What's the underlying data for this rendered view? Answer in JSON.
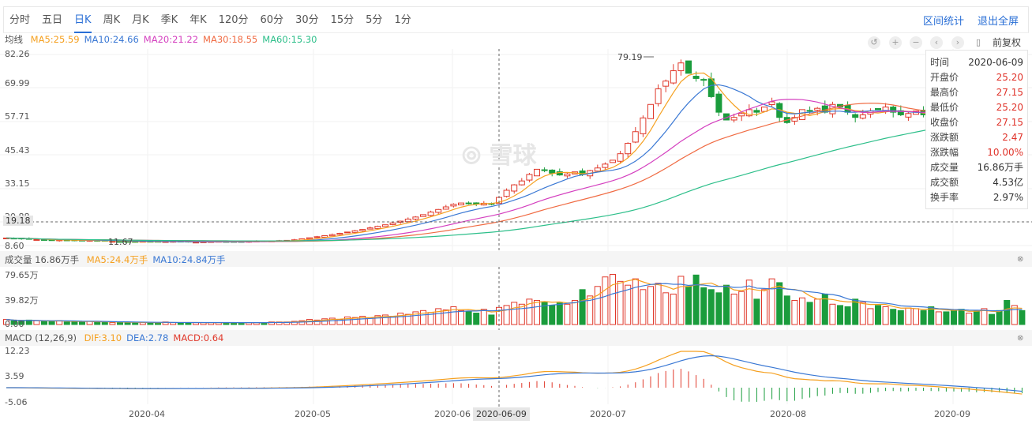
{
  "tabs": [
    "分时",
    "五日",
    "日K",
    "周K",
    "月K",
    "季K",
    "年K",
    "120分",
    "60分",
    "30分",
    "15分",
    "5分",
    "1分"
  ],
  "active_tab": "日K",
  "links": {
    "range_stats": "区间统计",
    "exit_fullscreen": "退出全屏"
  },
  "toolbar": {
    "adjust": "前复权",
    "icons": [
      "undo-icon",
      "zoom-in-icon",
      "zoom-out-icon",
      "prev-icon",
      "next-icon",
      "battery-icon"
    ]
  },
  "ma_legend": {
    "label": "均线",
    "ma5": "MA5:25.59",
    "ma10": "MA10:24.66",
    "ma20": "MA20:21.22",
    "ma30": "MA30:18.55",
    "ma60": "MA60:15.30"
  },
  "vol_legend": {
    "label": "成交量 16.86万手",
    "ma5": "MA5:24.4万手",
    "ma10": "MA10:24.84万手"
  },
  "macd_legend": {
    "label": "MACD (12,26,9)",
    "dif": "DIF:3.10",
    "dea": "DEA:2.78",
    "macd": "MACD:0.64"
  },
  "price_axis": [
    "82.26",
    "69.99",
    "57.71",
    "45.43",
    "33.15",
    "20.88",
    "8.60"
  ],
  "vol_axis": [
    "79.65万",
    "39.82万",
    "0.00"
  ],
  "macd_axis": [
    "12.23",
    "3.59",
    "-5.06"
  ],
  "x_axis": [
    "2020-04",
    "2020-05",
    "2020-06",
    "2020-07",
    "2020-08",
    "2020-09"
  ],
  "crosshair": {
    "date": "2020-06-09",
    "price": "19.18"
  },
  "annotations": {
    "high": "79.19",
    "low": "11.67"
  },
  "watermark": "雪球",
  "info": [
    {
      "k": "时间",
      "v": "2020-06-09",
      "red": false
    },
    {
      "k": "开盘价",
      "v": "25.20",
      "red": true
    },
    {
      "k": "最高价",
      "v": "27.15",
      "red": true
    },
    {
      "k": "最低价",
      "v": "25.20",
      "red": true
    },
    {
      "k": "收盘价",
      "v": "27.15",
      "red": true
    },
    {
      "k": "涨跌额",
      "v": "2.47",
      "red": true
    },
    {
      "k": "涨跌幅",
      "v": "10.00%",
      "red": true
    },
    {
      "k": "成交量",
      "v": "16.86万手",
      "red": false
    },
    {
      "k": "成交额",
      "v": "4.53亿",
      "red": false
    },
    {
      "k": "换手率",
      "v": "2.97%",
      "red": false
    }
  ],
  "colors": {
    "up": "#e0392b",
    "down": "#1a9c3c",
    "ma5": "#f5a020",
    "ma10": "#3a78d4",
    "ma20": "#d43fbf",
    "ma30": "#f06b43",
    "ma60": "#2dbf8a",
    "link": "#2a6fd6"
  },
  "chart_data": {
    "type": "candlestick",
    "price_range": [
      8.6,
      82.26
    ],
    "volume_range": [
      0,
      79.65
    ],
    "macd_range": [
      -5.06,
      12.23
    ],
    "closes": [
      11.5,
      11.4,
      11.2,
      11.0,
      10.9,
      10.7,
      10.6,
      10.8,
      10.7,
      10.5,
      10.4,
      10.6,
      10.5,
      10.3,
      10.2,
      10.1,
      10.0,
      10.1,
      10.2,
      10.1,
      10.0,
      10.1,
      10.2,
      10.1,
      10.0,
      9.9,
      10.0,
      10.1,
      10.2,
      10.1,
      10.0,
      10.1,
      10.2,
      10.3,
      10.2,
      10.4,
      10.5,
      10.6,
      10.8,
      11.2,
      11.6,
      12.0,
      12.4,
      12.8,
      13.3,
      13.8,
      14.3,
      14.8,
      15.4,
      16.0,
      16.6,
      17.3,
      18.0,
      18.8,
      19.6,
      20.5,
      21.5,
      22.5,
      23.5,
      24.5,
      25.0,
      24.8,
      24.6,
      24.9,
      24.7,
      27.15,
      29.9,
      32.0,
      33.5,
      36.0,
      38.0,
      37.5,
      36.5,
      35.8,
      36.2,
      37.0,
      36.0,
      37.5,
      38.5,
      40.0,
      41.5,
      44.0,
      48.0,
      52.5,
      57.8,
      63.0,
      69.0,
      72.0,
      76.0,
      79.0,
      75.0,
      73.0,
      72.5,
      66.0,
      60.0,
      57.0,
      58.0,
      59.5,
      61.0,
      60.0,
      62.0,
      64.0,
      58.0,
      56.0,
      58.0,
      61.0,
      60.5,
      61.5,
      60.0,
      63.0,
      62.0,
      60.0,
      58.0,
      59.0,
      60.5,
      61.0,
      62.0,
      60.0,
      59.0,
      59.5,
      60.5,
      59.0,
      58.5,
      58.0,
      57.0,
      57.5,
      56.0,
      56.5,
      54.0,
      55.0,
      53.5,
      52.5,
      51.0,
      50.5,
      49.5
    ],
    "volumes": [
      8,
      6,
      5,
      7,
      6,
      5,
      5,
      6,
      4,
      5,
      4,
      5,
      4,
      4,
      3,
      4,
      3,
      3,
      3,
      3,
      3,
      4,
      3,
      3,
      3,
      3,
      3,
      3,
      3,
      3,
      3,
      3,
      3,
      3,
      3,
      4,
      4,
      4,
      5,
      6,
      8,
      7,
      9,
      10,
      8,
      12,
      11,
      13,
      10,
      14,
      15,
      13,
      18,
      16,
      20,
      22,
      19,
      25,
      23,
      28,
      22,
      20,
      18,
      24,
      15,
      27,
      30,
      35,
      32,
      40,
      38,
      36,
      30,
      34,
      32,
      38,
      55,
      45,
      60,
      75,
      79,
      68,
      62,
      72,
      55,
      60,
      65,
      50,
      48,
      76,
      60,
      78,
      58,
      55,
      50,
      62,
      48,
      52,
      70,
      40,
      55,
      72,
      66,
      45,
      38,
      42,
      35,
      40,
      48,
      32,
      30,
      28,
      40,
      35,
      25,
      30,
      28,
      24,
      22,
      26,
      25,
      22,
      28,
      20,
      20,
      22,
      24,
      18,
      21,
      25,
      16,
      22,
      38,
      30,
      22
    ]
  }
}
